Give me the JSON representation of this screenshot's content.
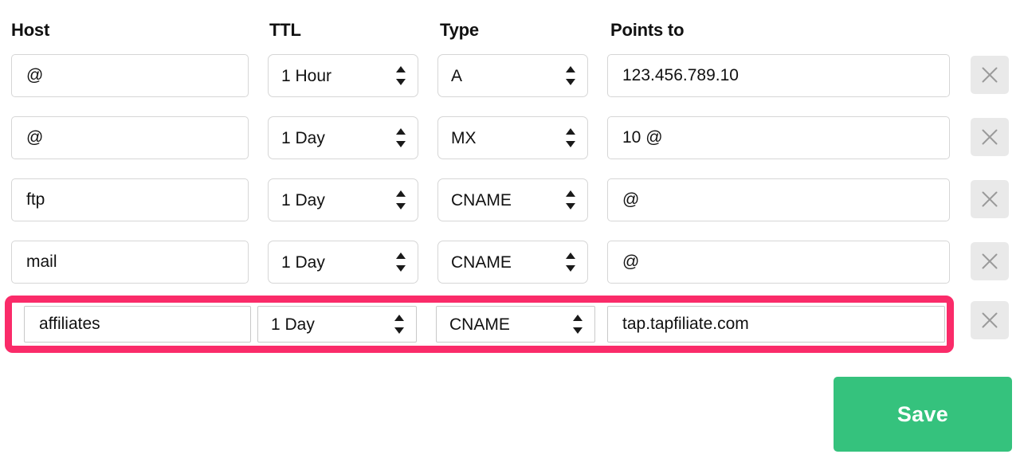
{
  "table": {
    "columns": [
      {
        "key": "host",
        "label": "Host"
      },
      {
        "key": "ttl",
        "label": "TTL"
      },
      {
        "key": "type",
        "label": "Type"
      },
      {
        "key": "points",
        "label": "Points to"
      }
    ],
    "rows": [
      {
        "host": "@",
        "host_placeholder": "Host",
        "ttl": "1 Hour",
        "type": "A",
        "points_to": "123.456.789.10",
        "points_placeholder": "Points to",
        "delete_label": "Delete record",
        "highlighted": false
      },
      {
        "host": "@",
        "host_placeholder": "Host",
        "ttl": "1 Day",
        "type": "MX",
        "points_to": "10 @",
        "points_placeholder": "Points to",
        "delete_label": "Delete record",
        "highlighted": false
      },
      {
        "host": "ftp",
        "host_placeholder": "Host",
        "ttl": "1 Day",
        "type": "CNAME",
        "points_to": "@",
        "points_placeholder": "Points to",
        "delete_label": "Delete record",
        "highlighted": false
      },
      {
        "host": "mail",
        "host_placeholder": "Host",
        "ttl": "1 Day",
        "type": "CNAME",
        "points_to": "@",
        "points_placeholder": "Points to",
        "delete_label": "Delete record",
        "highlighted": false
      },
      {
        "host": "affiliates",
        "host_placeholder": "Host",
        "ttl": "1 Day",
        "type": "CNAME",
        "points_to": "tap.tapfiliate.com",
        "points_placeholder": "Points to",
        "delete_label": "Delete record",
        "highlighted": true
      }
    ]
  },
  "footer": {
    "save_label": "Save"
  },
  "icons": {
    "delete": "close-x-icon",
    "select_spinner": "spinner-up-down-icon"
  },
  "colors": {
    "highlight": "#fa2b69",
    "save_button": "#35c27d",
    "field_border": "#d6d6d6",
    "delete_button_bg": "#e9e9e9",
    "text": "#111111"
  }
}
